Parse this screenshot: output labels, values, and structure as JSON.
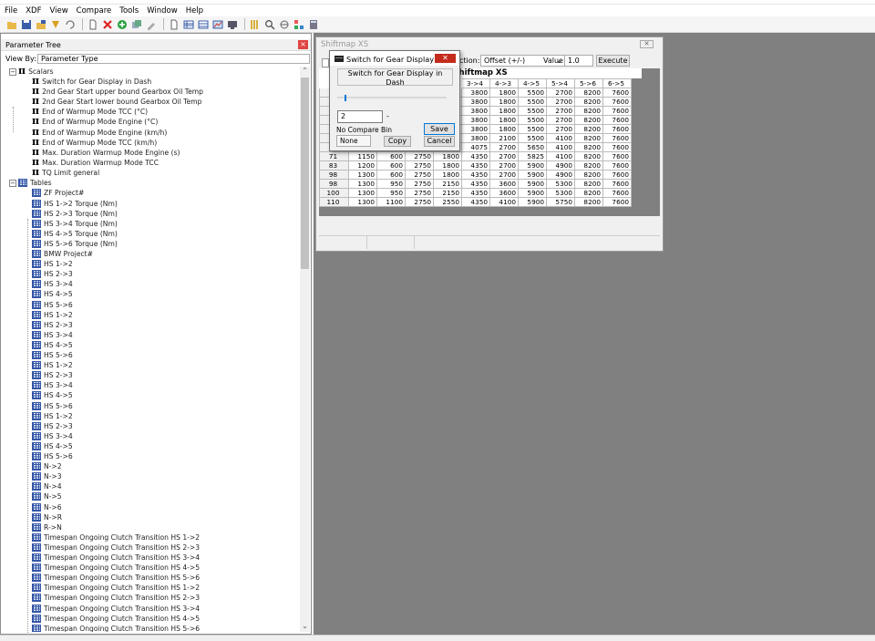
{
  "menu": [
    "File",
    "XDF",
    "View",
    "Compare",
    "Tools",
    "Window",
    "Help"
  ],
  "toolbar_icons": [
    "open-folder",
    "save",
    "save-all",
    "import",
    "undo",
    "new-document",
    "delete",
    "add",
    "duplicate",
    "edit",
    "new-blank",
    "view-table",
    "view-list",
    "view-chart",
    "monitor",
    "grid-options",
    "search",
    "compare",
    "hierarchy",
    "calculator"
  ],
  "param_tree": {
    "title": "Parameter Tree",
    "view_by_label": "View By:",
    "view_by_value": "Parameter Type",
    "scalars_label": "Scalars",
    "scalars": [
      "Switch for Gear Display in Dash",
      "2nd Gear Start upper bound Gearbox Oil Temp",
      "2nd Gear Start lower bound Gearbox Oil Temp",
      "End of Warmup Mode TCC (°C)",
      "End of Warmup Mode Engine (°C)",
      "End of Warmup Mode Engine (km/h)",
      "End of Warmup Mode TCC (km/h)",
      "Max. Duration Warmup Mode Engine (s)",
      "Max. Duration Warmup Mode TCC",
      "TQ Limit general"
    ],
    "tables_label": "Tables",
    "tables": [
      "ZF Project#",
      "HS 1->2 Torque (Nm)",
      "HS 2->3 Torque (Nm)",
      "HS 3->4 Torque (Nm)",
      "HS 4->5 Torque (Nm)",
      "HS 5->6 Torque (Nm)",
      "BMW Project#",
      "HS 1->2",
      "HS 2->3",
      "HS 3->4",
      "HS 4->5",
      "HS 5->6",
      "HS 1->2",
      "HS 2->3",
      "HS 3->4",
      "HS 4->5",
      "HS 5->6",
      "HS 1->2",
      "HS 2->3",
      "HS 3->4",
      "HS 4->5",
      "HS 5->6",
      "HS 1->2",
      "HS 2->3",
      "HS 3->4",
      "HS 4->5",
      "HS 5->6",
      "N->2",
      "N->3",
      "N->4",
      "N->5",
      "N->6",
      "N->R",
      "R->N",
      "Timespan Ongoing Clutch Transition HS 1->2",
      "Timespan Ongoing Clutch Transition HS 2->3",
      "Timespan Ongoing Clutch Transition HS 3->4",
      "Timespan Ongoing Clutch Transition HS 4->5",
      "Timespan Ongoing Clutch Transition HS 5->6",
      "Timespan Ongoing Clutch Transition HS 1->2",
      "Timespan Ongoing Clutch Transition HS 2->3",
      "Timespan Ongoing Clutch Transition HS 3->4",
      "Timespan Ongoing Clutch Transition HS 4->5",
      "Timespan Ongoing Clutch Transition HS 5->6"
    ]
  },
  "shiftmap": {
    "title": "Shiftmap XS",
    "function_label": "ction:",
    "function_value": "Offset (+/-)",
    "value_label": "Value:",
    "value": "1.0",
    "execute_label": "Execute",
    "table_title": "Shiftmap XS",
    "columns": [
      "3->4",
      "4->3",
      "4->5",
      "5->4",
      "5->6",
      "6->5"
    ],
    "rows": [
      [
        "",
        "",
        "",
        "",
        "3800",
        "1800",
        "5500",
        "2700",
        "8200",
        "7600"
      ],
      [
        "",
        "",
        "",
        "",
        "3800",
        "1800",
        "5500",
        "2700",
        "8200",
        "7600"
      ],
      [
        "",
        "",
        "",
        "",
        "3800",
        "1800",
        "5500",
        "2700",
        "8200",
        "7600"
      ],
      [
        "",
        "",
        "",
        "",
        "3800",
        "1800",
        "5500",
        "2700",
        "8200",
        "7600"
      ],
      [
        "",
        "",
        "",
        "",
        "3800",
        "1800",
        "5500",
        "2700",
        "8200",
        "7600"
      ],
      [
        "",
        "",
        "",
        "",
        "3800",
        "2100",
        "5500",
        "4100",
        "8200",
        "7600"
      ],
      [
        "",
        "",
        "",
        "",
        "4075",
        "2700",
        "5650",
        "4100",
        "8200",
        "7600"
      ],
      [
        "71",
        "1150",
        "600",
        "2750",
        "1800",
        "4350",
        "2700",
        "5825",
        "4100",
        "8200",
        "7600"
      ],
      [
        "83",
        "1200",
        "600",
        "2750",
        "1800",
        "4350",
        "2700",
        "5900",
        "4900",
        "8200",
        "7600"
      ],
      [
        "98",
        "1300",
        "600",
        "2750",
        "1800",
        "4350",
        "2700",
        "5900",
        "4900",
        "8200",
        "7600"
      ],
      [
        "98",
        "1300",
        "950",
        "2750",
        "2150",
        "4350",
        "3600",
        "5900",
        "5300",
        "8200",
        "7600"
      ],
      [
        "100",
        "1300",
        "950",
        "2750",
        "2150",
        "4350",
        "3600",
        "5900",
        "5300",
        "8200",
        "7600"
      ],
      [
        "110",
        "1300",
        "1100",
        "2750",
        "2550",
        "4350",
        "4100",
        "5900",
        "5750",
        "8200",
        "7600"
      ]
    ]
  },
  "dialog": {
    "title": "Switch for Gear Display i...",
    "description": "Switch for Gear Display in Dash",
    "slider_fraction": 0.02,
    "value": "2",
    "unit": "-",
    "compare_label": "No Compare Bin",
    "compare_value": "None",
    "save_label": "Save",
    "copy_label": "Copy",
    "cancel_label": "Cancel"
  }
}
